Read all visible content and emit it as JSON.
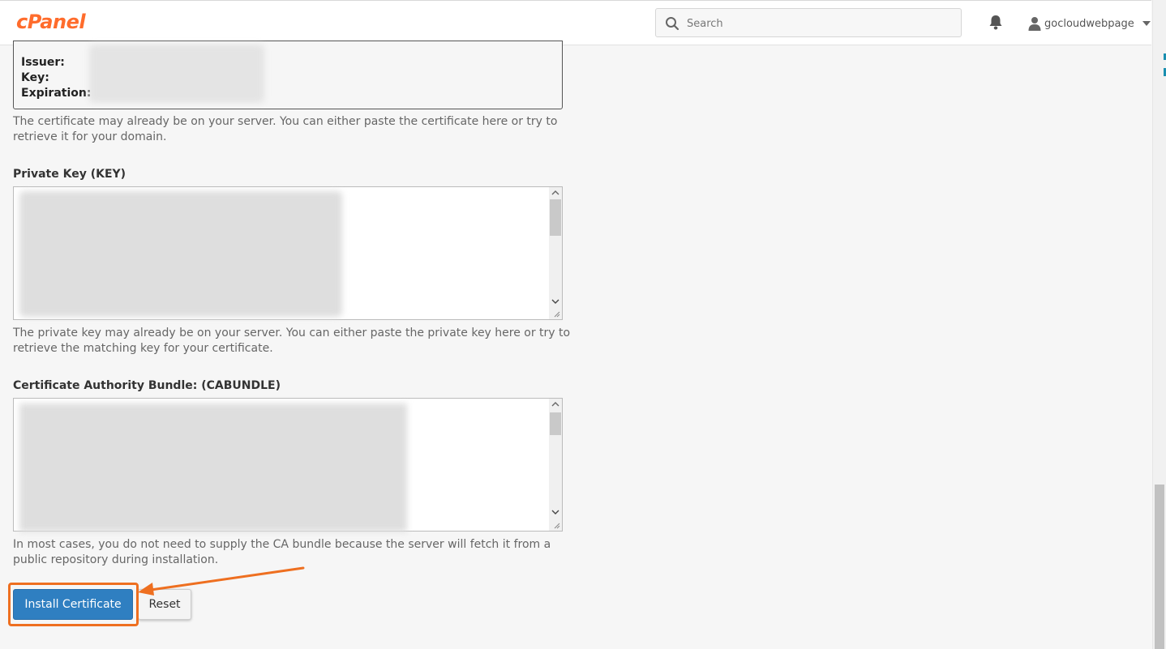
{
  "header": {
    "logo": "cPanel",
    "search_placeholder": "Search",
    "username": "gocloudwebpage"
  },
  "certificate_info": {
    "issuer_label": "Issuer:",
    "key_label": "Key:",
    "expiration_label": "Expiration:",
    "help_text": "The certificate may already be on your server. You can either paste the certificate here or try to retrieve it for your domain."
  },
  "private_key": {
    "label": "Private Key (KEY)",
    "help_text": "The private key may already be on your server. You can either paste the private key here or try to retrieve the matching key for your certificate."
  },
  "ca_bundle": {
    "label": "Certificate Authority Bundle: (CABUNDLE)",
    "help_text": "In most cases, you do not need to supply the CA bundle because the server will fetch it from a public repository during installation."
  },
  "actions": {
    "install_label": "Install Certificate",
    "reset_label": "Reset"
  },
  "colors": {
    "brand": "#ff6c2c",
    "primary_button": "#2f7fc1",
    "highlight": "#ee6f20"
  }
}
